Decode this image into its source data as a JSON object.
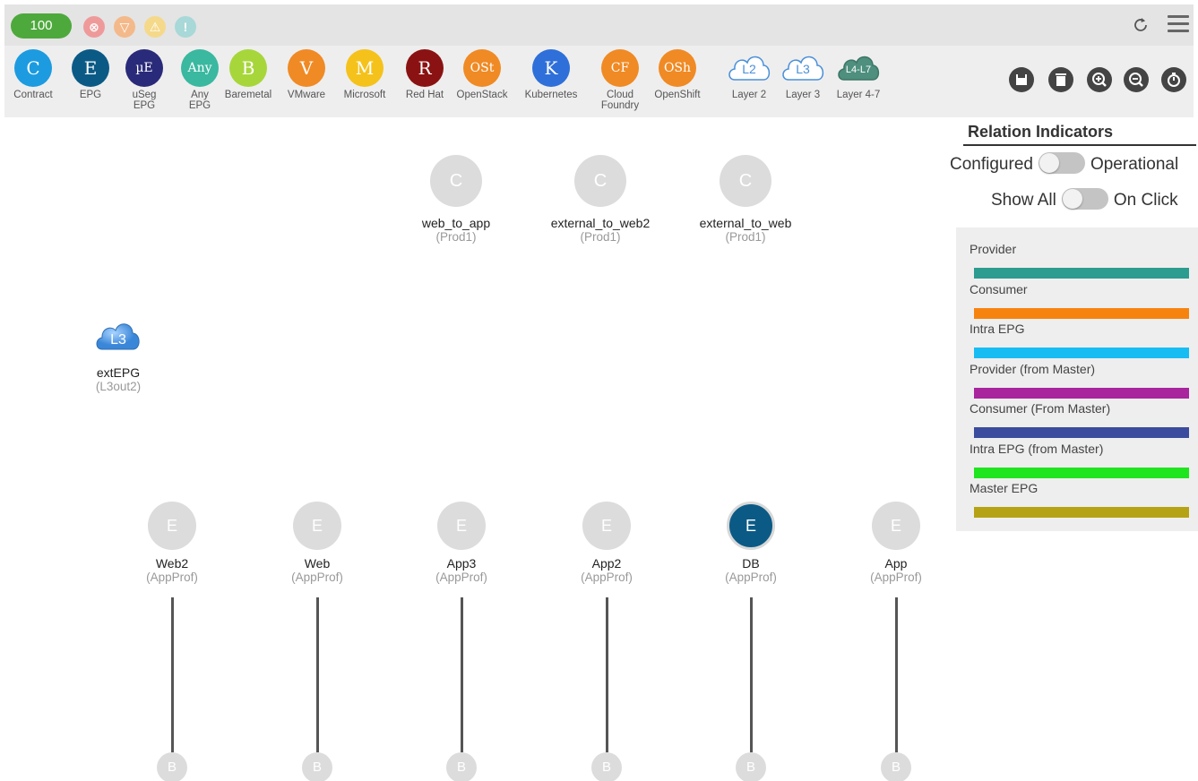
{
  "topbar": {
    "count": "100",
    "faults": [
      {
        "icon": "critical-fault-icon",
        "glyph": "⊗",
        "color": "#ef9a9a"
      },
      {
        "icon": "major-fault-icon",
        "glyph": "▽",
        "color": "#f4b98a"
      },
      {
        "icon": "minor-fault-icon",
        "glyph": "⚠",
        "color": "#f5d98a"
      },
      {
        "icon": "warning-fault-icon",
        "glyph": "!",
        "color": "#a8d8d8"
      }
    ]
  },
  "palette": [
    {
      "id": "contract",
      "glyph": "C",
      "label": "Contract",
      "color": "#1c9be0"
    },
    {
      "id": "epg",
      "glyph": "E",
      "label": "EPG",
      "color": "#0b5a86"
    },
    {
      "id": "useg-epg",
      "glyph": "µE",
      "label": "uSeg\nEPG",
      "color": "#2a2a7a"
    },
    {
      "id": "any-epg",
      "glyph": "Any",
      "label": "Any\nEPG",
      "color": "#3ab8a0"
    },
    {
      "id": "baremetal",
      "glyph": "B",
      "label": "Baremetal",
      "color": "#a7d63b"
    },
    {
      "id": "vmware",
      "glyph": "V",
      "label": "VMware",
      "color": "#f08a24"
    },
    {
      "id": "microsoft",
      "glyph": "M",
      "label": "Microsoft",
      "color": "#f5c21b"
    },
    {
      "id": "redhat",
      "glyph": "R",
      "label": "Red Hat",
      "color": "#8b1212"
    },
    {
      "id": "openstack",
      "glyph": "OSt",
      "label": "OpenStack",
      "color": "#f08a24"
    },
    {
      "id": "kubernetes",
      "glyph": "K",
      "label": "Kubernetes",
      "color": "#2f6fd9"
    },
    {
      "id": "cloud-foundry",
      "glyph": "CF",
      "label": "Cloud\nFoundry",
      "color": "#f08a24"
    },
    {
      "id": "openshift",
      "glyph": "OSh",
      "label": "OpenShift",
      "color": "#f08a24"
    }
  ],
  "clouds": [
    {
      "id": "layer-2",
      "glyph": "L2",
      "label": "Layer 2"
    },
    {
      "id": "layer-3",
      "glyph": "L3",
      "label": "Layer 3"
    },
    {
      "id": "layer-4-7",
      "glyph": "L4-L7",
      "label": "Layer 4-7"
    }
  ],
  "actions": [
    "save-icon",
    "delete-icon",
    "zoom-in-icon",
    "zoom-out-icon",
    "reset-icon"
  ],
  "contracts": [
    {
      "name": "web_to_app",
      "sub": "(Prod1)",
      "glyph": "C"
    },
    {
      "name": "external_to_web2",
      "sub": "(Prod1)",
      "glyph": "C"
    },
    {
      "name": "external_to_web",
      "sub": "(Prod1)",
      "glyph": "C"
    }
  ],
  "ext_epg": {
    "glyph": "L3",
    "name": "extEPG",
    "sub": "(L3out2)"
  },
  "epgs": [
    {
      "name": "Web2",
      "sub": "(AppProf)",
      "glyph": "E",
      "active": false
    },
    {
      "name": "Web",
      "sub": "(AppProf)",
      "glyph": "E",
      "active": false
    },
    {
      "name": "App3",
      "sub": "(AppProf)",
      "glyph": "E",
      "active": false
    },
    {
      "name": "App2",
      "sub": "(AppProf)",
      "glyph": "E",
      "active": false
    },
    {
      "name": "DB",
      "sub": "(AppProf)",
      "glyph": "E",
      "active": true
    },
    {
      "name": "App",
      "sub": "(AppProf)",
      "glyph": "E",
      "active": false
    }
  ],
  "baremetal_glyph": "B",
  "relation": {
    "title": "Relation Indicators",
    "toggle1_left": "Configured",
    "toggle1_right": "Operational",
    "toggle2_left": "Show All",
    "toggle2_right": "On Click",
    "legend": [
      {
        "label": "Provider",
        "color": "#2b9c8f"
      },
      {
        "label": "Consumer",
        "color": "#f7830f"
      },
      {
        "label": "Intra EPG",
        "color": "#17bdf2"
      },
      {
        "label": "Provider (from Master)",
        "color": "#a8259e"
      },
      {
        "label": "Consumer (From Master)",
        "color": "#3b4c9e"
      },
      {
        "label": "Intra EPG (from Master)",
        "color": "#1ee51e"
      },
      {
        "label": "Master EPG",
        "color": "#b5a315"
      }
    ]
  }
}
